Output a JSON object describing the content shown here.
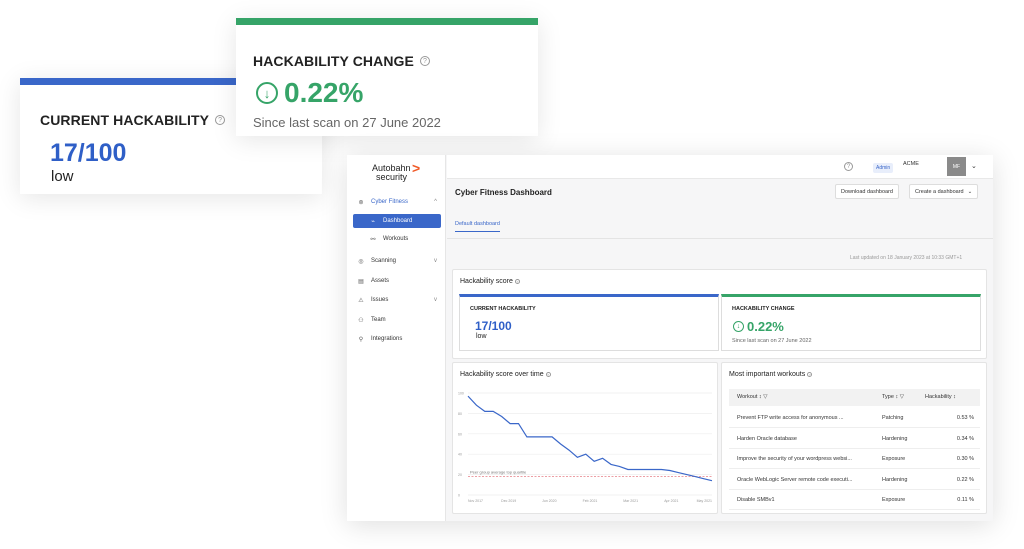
{
  "current_card": {
    "title": "CURRENT HACKABILITY",
    "score": "17/100",
    "level": "low"
  },
  "change_card": {
    "title": "HACKABILITY CHANGE",
    "arrow": "↓",
    "value": "0.22%",
    "since": "Since last scan on 27 June 2022"
  },
  "app": {
    "logo_text_1": "Autobahn",
    "logo_text_2": "security",
    "logo_mark": ">",
    "sidebar": {
      "items": [
        {
          "label": "Cyber Fitness",
          "icon": "binoculars-icon",
          "glyph": "⊚",
          "chevron": "^"
        },
        {
          "label": "Dashboard",
          "icon": "chart-icon",
          "glyph": "⌁"
        },
        {
          "label": "Workouts",
          "icon": "workouts-icon",
          "glyph": "⚯"
        },
        {
          "label": "Scanning",
          "icon": "scan-icon",
          "glyph": "◎",
          "chevron": "v"
        },
        {
          "label": "Assets",
          "icon": "assets-icon",
          "glyph": "▤"
        },
        {
          "label": "Issues",
          "icon": "issues-icon",
          "glyph": "⚠",
          "chevron": "v"
        },
        {
          "label": "Team",
          "icon": "team-icon",
          "glyph": "⚇"
        },
        {
          "label": "Integrations",
          "icon": "integrations-icon",
          "glyph": "⚲"
        }
      ]
    },
    "topbar": {
      "help_glyph": "?",
      "role": "Admin",
      "org": "ACME",
      "avatar": "MF",
      "chevron": "⌄"
    },
    "header": {
      "title": "Cyber Fitness Dashboard",
      "download_label": "Download dashboard",
      "create_label": "Create a dashboard",
      "create_chevron": "⌄"
    },
    "tab": "Default dashboard",
    "last_updated": "Last updated on 18 January 2023 at 10:33 GMT+1",
    "hack_score": {
      "title": "Hackability score",
      "help_glyph": "?",
      "current": {
        "title": "CURRENT HACKABILITY",
        "score": "17/100",
        "level": "low"
      },
      "change": {
        "title": "HACKABILITY CHANGE",
        "arrow": "↓",
        "value": "0.22%",
        "since": "Since last scan on 27 June 2022"
      }
    },
    "over_time": {
      "title": "Hackability score over time",
      "help_glyph": "?"
    },
    "workouts": {
      "title": "Most important workouts",
      "help_glyph": "?",
      "columns": {
        "workout": "Workout",
        "workout_icons": "↕ ▽",
        "type": "Type",
        "type_icons": "↕ ▽",
        "hackability": "Hackability",
        "hack_icon": "↕"
      },
      "rows": [
        {
          "workout": "Prevent FTP write access for anonymous ...",
          "type": "Patching",
          "hackability": "0.53 %"
        },
        {
          "workout": "Harden Oracle database",
          "type": "Hardening",
          "hackability": "0.34 %"
        },
        {
          "workout": "Improve the security of your wordpress websi...",
          "type": "Exposure",
          "hackability": "0.30 %"
        },
        {
          "workout": "Oracle WebLogic Server remote code executi...",
          "type": "Hardening",
          "hackability": "0.22 %"
        },
        {
          "workout": "Disable SMBv1",
          "type": "Exposure",
          "hackability": "0.11 %"
        }
      ]
    }
  },
  "chart_data": {
    "type": "line",
    "title": "Hackability score over time",
    "x_ticks": [
      "Nov 2017",
      "Dec 2019",
      "Jun 2020",
      "Feb 2021",
      "Mar 2021",
      "Apr 2021",
      "May 2021"
    ],
    "y_ticks": [
      "100",
      "80",
      "60",
      "40",
      "20",
      "0"
    ],
    "ylim": [
      0,
      100
    ],
    "series": [
      {
        "name": "",
        "color": "#3a67c9",
        "values": [
          97,
          88,
          82,
          82,
          77,
          70,
          70,
          57,
          57,
          57,
          57,
          50,
          44,
          37,
          40,
          33,
          36,
          30,
          28,
          25,
          25,
          25,
          25,
          25,
          24,
          22,
          20,
          18,
          16,
          14
        ]
      }
    ],
    "reference_line": {
      "label": "Peer group average top quartile",
      "value": 18,
      "color": "#e57f86"
    },
    "grid": true
  },
  "colors": {
    "blue": "#3a67c9",
    "green": "#36a468",
    "orange": "#f05a28"
  }
}
